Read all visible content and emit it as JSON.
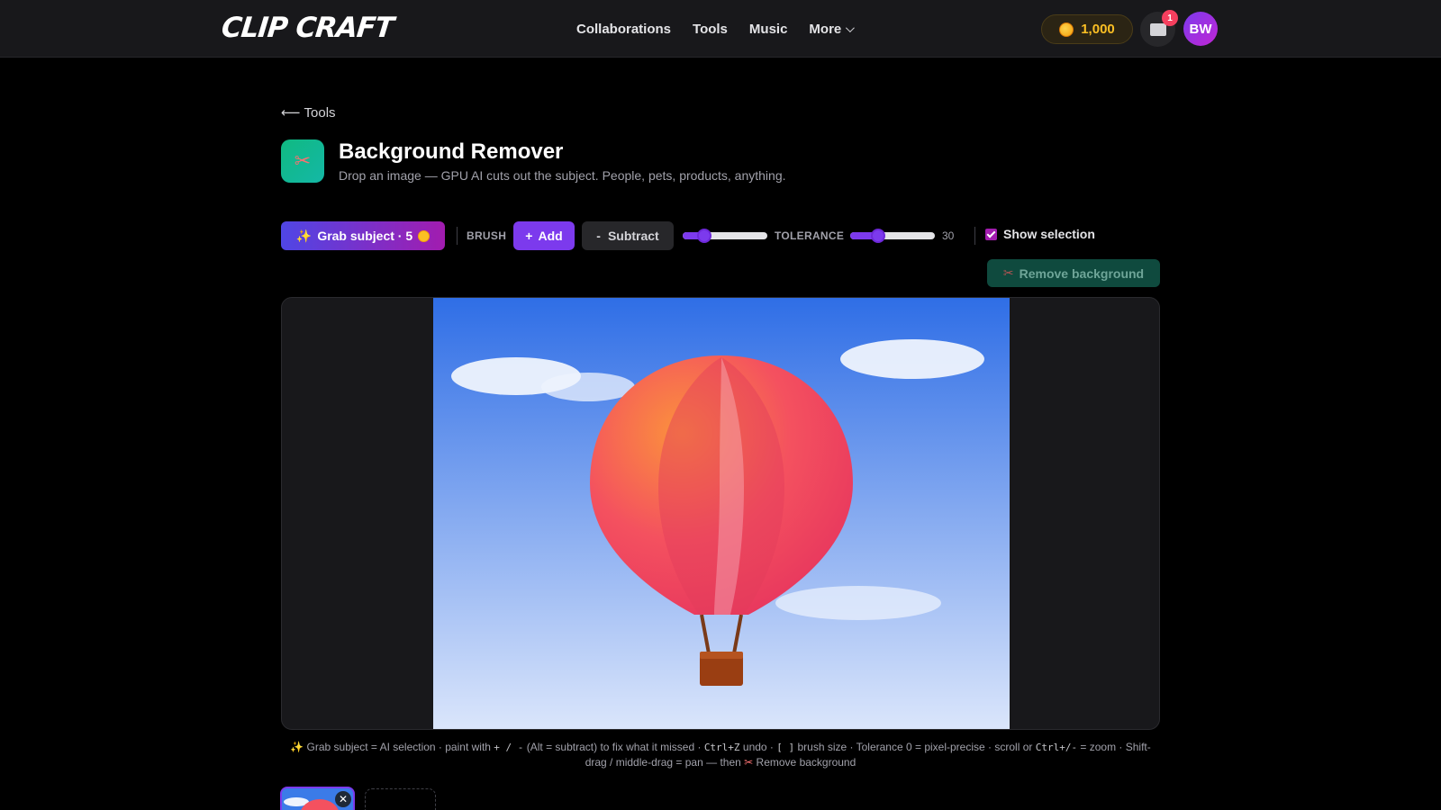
{
  "brand": {
    "logo_text": "CLIP CRAFT"
  },
  "nav": {
    "items": [
      "Collaborations",
      "Tools",
      "Music"
    ],
    "more_label": "More"
  },
  "account": {
    "coins": "1,000",
    "notifications": "1",
    "initials": "BW"
  },
  "page": {
    "back_label": "Tools",
    "title": "Background Remover",
    "subtitle": "Drop an image — GPU AI cuts out the subject. People, pets, products, anything."
  },
  "toolbar": {
    "grab_label": "Grab subject · 5",
    "brush_label": "BRUSH",
    "add_label": "Add",
    "subtract_label": "Subtract",
    "brush_size_fraction": 0.25,
    "tolerance_label": "TOLERANCE",
    "tolerance_value": "30",
    "tolerance_fraction": 0.33,
    "show_selection_label": "Show selection",
    "show_selection_checked": true,
    "remove_label": "Remove background"
  },
  "hint": {
    "p1": "Grab subject = AI selection · paint with ",
    "k1": "+ / -",
    "p2": " (Alt = subtract) to fix what it missed · ",
    "k2": "Ctrl+Z",
    "p3": " undo · ",
    "k3": "[ ]",
    "p4": " brush size · Tolerance 0 = pixel-precise · scroll or ",
    "k4": "Ctrl+/-",
    "p5": " = zoom · Shift-drag / middle-drag = pan — then ",
    "p6": "Remove background"
  },
  "colors": {
    "accent": "#7c3aed",
    "remove_bg": "#0f4a3e",
    "sky_top": "#2f6ee6",
    "sky_bottom": "#dbe6fb"
  },
  "icons": {
    "grab": "sparkles-icon",
    "remove": "scissors-icon",
    "tool": "scissors-icon",
    "inbox": "inbox-icon"
  }
}
